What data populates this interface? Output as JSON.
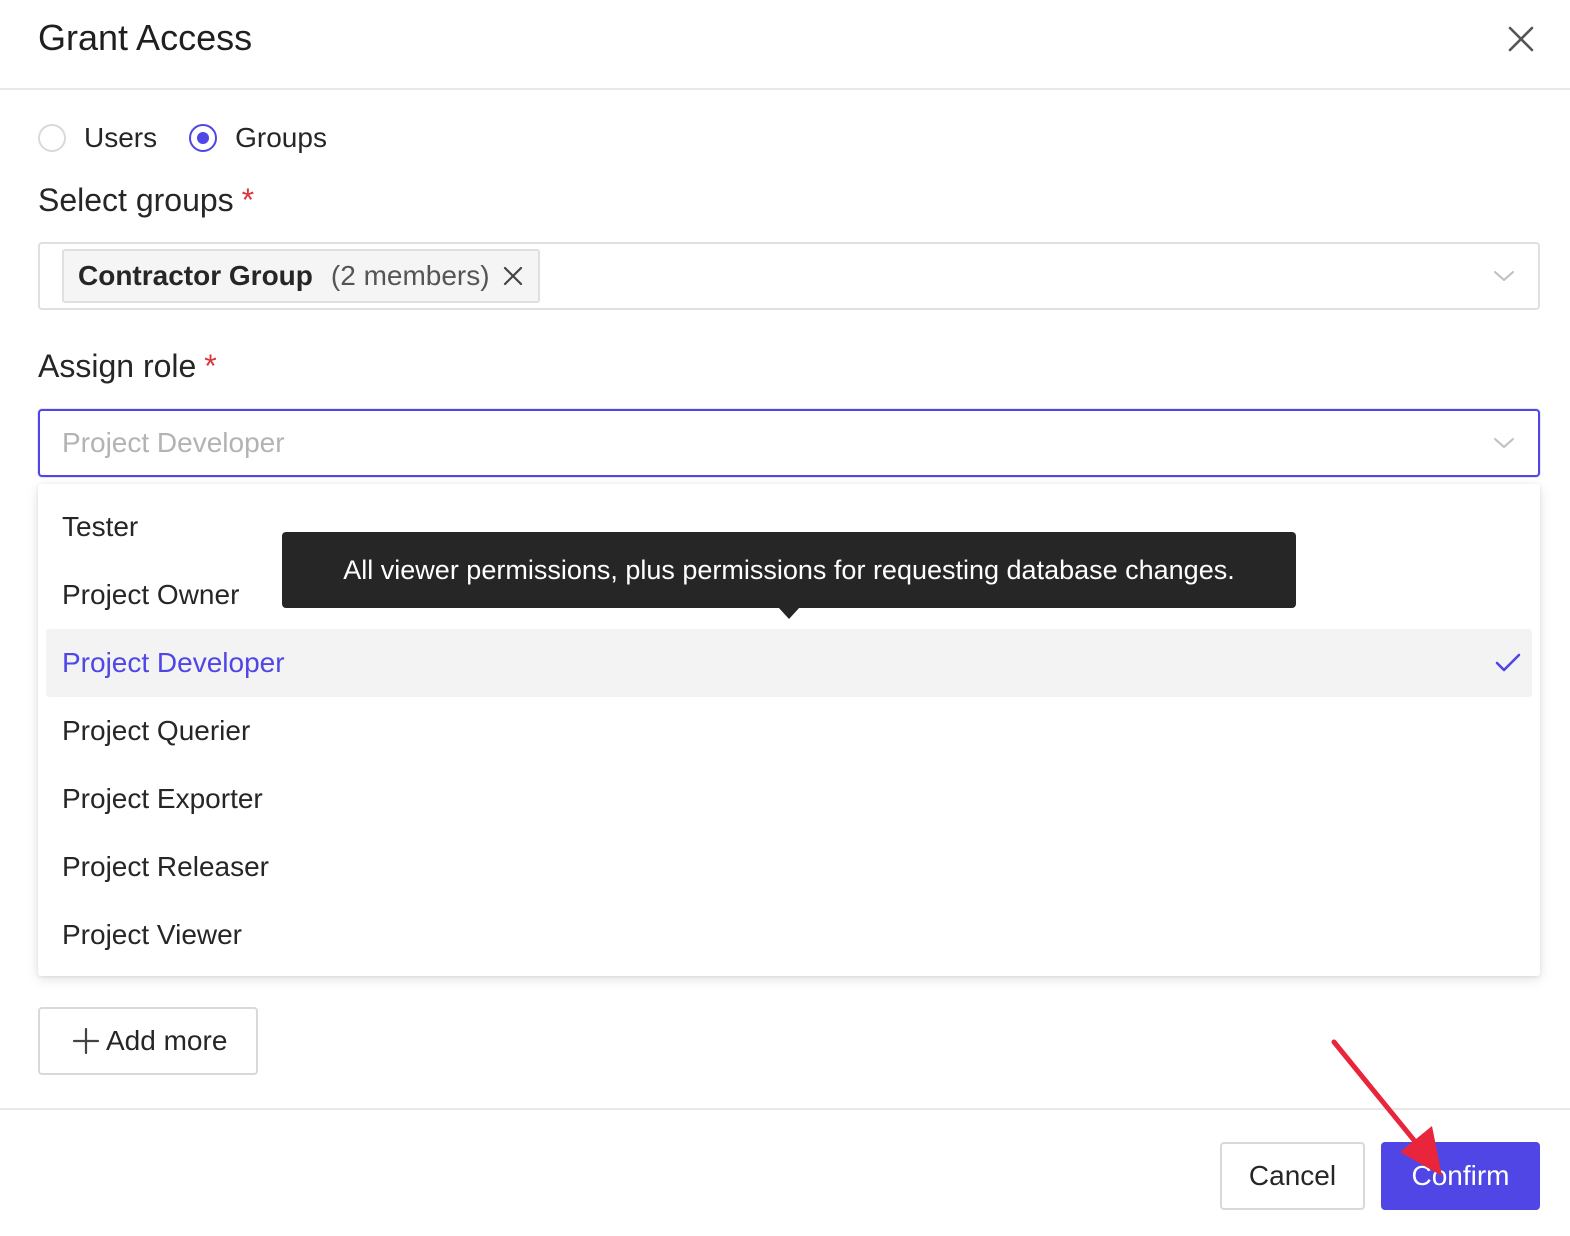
{
  "dialog": {
    "title": "Grant Access"
  },
  "target_type": {
    "options": [
      {
        "label": "Users",
        "checked": false
      },
      {
        "label": "Groups",
        "checked": true
      }
    ]
  },
  "groups_field": {
    "label": "Select groups",
    "required_mark": "*",
    "selected_tags": [
      {
        "name": "Contractor Group",
        "count": "(2 members)"
      }
    ]
  },
  "role_field": {
    "label": "Assign role",
    "required_mark": "*",
    "placeholder": "Project Developer",
    "options": [
      {
        "label": "Tester",
        "selected": false
      },
      {
        "label": "Project Owner",
        "selected": false
      },
      {
        "label": "Project Developer",
        "selected": true
      },
      {
        "label": "Project Querier",
        "selected": false
      },
      {
        "label": "Project Exporter",
        "selected": false
      },
      {
        "label": "Project Releaser",
        "selected": false
      },
      {
        "label": "Project Viewer",
        "selected": false
      }
    ]
  },
  "tooltip": {
    "text": "All viewer permissions, plus permissions for requesting database changes."
  },
  "add_more": {
    "label": "Add more"
  },
  "footer": {
    "cancel_label": "Cancel",
    "confirm_label": "Confirm"
  },
  "icons": {
    "close": "close-icon",
    "chevron": "chevron-down-icon",
    "tag_remove": "close-icon",
    "check": "check-icon",
    "plus": "plus-icon",
    "annotation": "red-arrow-annotation"
  },
  "colors": {
    "accent": "#4f46e5",
    "required": "#d9363e",
    "tooltip_bg": "#262626",
    "annotation": "#e8253a"
  }
}
